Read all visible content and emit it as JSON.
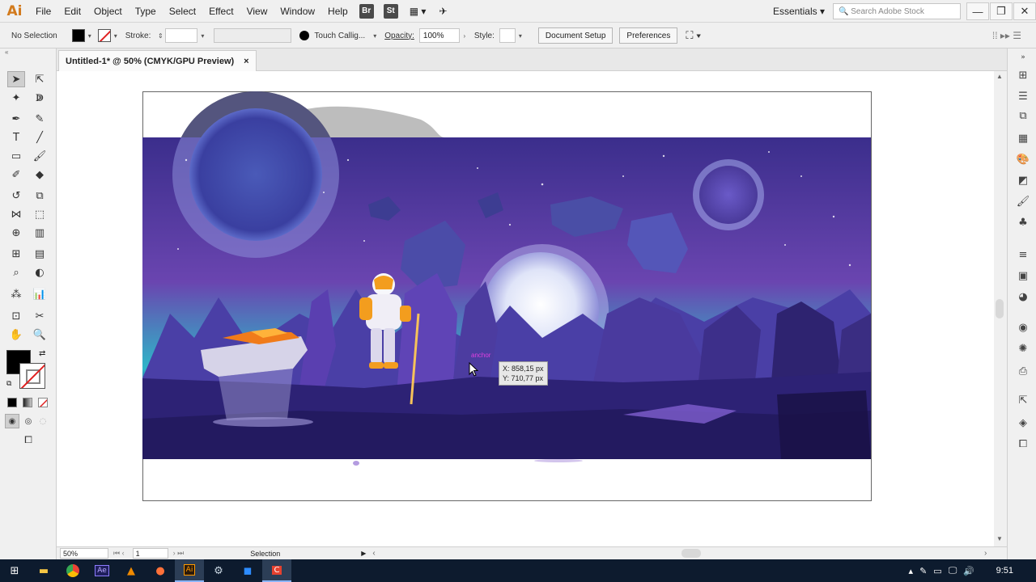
{
  "app": {
    "logo": "Ai"
  },
  "menu": [
    "File",
    "Edit",
    "Object",
    "Type",
    "Select",
    "Effect",
    "View",
    "Window",
    "Help"
  ],
  "bridge_buttons": [
    "Br",
    "St"
  ],
  "workspace": "Essentials",
  "search_placeholder": "Search Adobe Stock",
  "control": {
    "selection": "No Selection",
    "stroke_label": "Stroke:",
    "brush": "Touch Callig...",
    "opacity_label": "Opacity:",
    "opacity_value": "100%",
    "style_label": "Style:",
    "document_setup": "Document Setup",
    "preferences": "Preferences"
  },
  "doc_tab": {
    "title": "Untitled-1* @ 50% (CMYK/GPU Preview)",
    "close": "×"
  },
  "tooltip": {
    "x": "X: 858,15 px",
    "y": "Y: 710,77 px",
    "anchor": "anchor"
  },
  "status": {
    "zoom": "50%",
    "page": "1",
    "mode": "Selection"
  },
  "taskbar": {
    "time": "9:51"
  },
  "colors": {
    "accent": "#d27a1c",
    "sky_top": "#3b2e8c",
    "sky_mid": "#5a3fa8",
    "horizon": "#2fb6c8",
    "ground": "#2a1f6b"
  }
}
